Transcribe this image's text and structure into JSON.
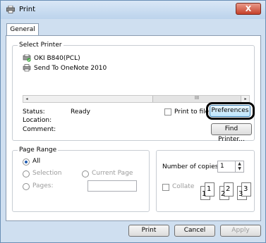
{
  "window": {
    "title": "Print",
    "close_glyph": "X"
  },
  "tabs": [
    {
      "label": "General"
    }
  ],
  "select_printer": {
    "legend": "Select Printer",
    "printers": [
      {
        "name": "OKI B840(PCL)"
      },
      {
        "name": "Send To OneNote 2010"
      }
    ],
    "scrollbar": {
      "left": "◂",
      "thumb": "III",
      "right": "▸"
    }
  },
  "status": {
    "status_label": "Status:",
    "status_value": "Ready",
    "location_label": "Location:",
    "comment_label": "Comment:",
    "print_to_file": "Print to file",
    "preferences": "Preferences",
    "find_printer": "Find Printer..."
  },
  "page_range": {
    "legend": "Page Range",
    "all": "All",
    "selection": "Selection",
    "current_page": "Current Page",
    "pages": "Pages:"
  },
  "copies": {
    "number_label": "Number of copies:",
    "number_value": "1",
    "collate": "Collate",
    "collate_pages": [
      "1",
      "1",
      "2",
      "2",
      "3",
      "3"
    ]
  },
  "footer": {
    "print": "Print",
    "cancel": "Cancel",
    "apply": "Apply"
  },
  "colors": {
    "highlight_ring": "#000000",
    "title_bg": "#c8dcf2",
    "close_btn": "#c5402a"
  }
}
